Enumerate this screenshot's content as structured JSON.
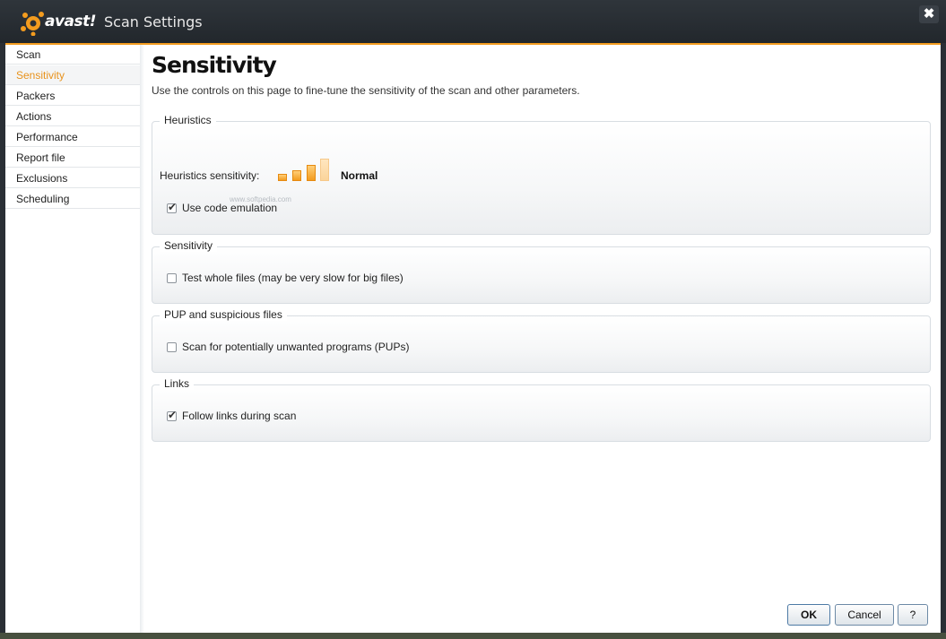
{
  "window": {
    "brand": "avast!",
    "title": "Scan Settings",
    "close_label": "✖"
  },
  "sidebar": {
    "items": [
      {
        "label": "Scan"
      },
      {
        "label": "Sensitivity"
      },
      {
        "label": "Packers"
      },
      {
        "label": "Actions"
      },
      {
        "label": "Performance"
      },
      {
        "label": "Report file"
      },
      {
        "label": "Exclusions"
      },
      {
        "label": "Scheduling"
      }
    ],
    "active_index": 1
  },
  "main": {
    "title": "Sensitivity",
    "description": "Use the controls on this page to fine-tune the sensitivity of the scan and other parameters.",
    "heuristics": {
      "group_label": "Heuristics",
      "sensitivity_label": "Heuristics sensitivity:",
      "level": "Normal",
      "level_bars_filled": 3,
      "level_bars_total": 4,
      "watermark": "www.softpedia.com",
      "code_emulation_label": "Use code emulation",
      "code_emulation_checked": true
    },
    "sensitivity": {
      "group_label": "Sensitivity",
      "whole_files_label": "Test whole files (may be very slow for big files)",
      "whole_files_checked": false
    },
    "pup": {
      "group_label": "PUP and suspicious files",
      "pup_label": "Scan for potentially unwanted programs (PUPs)",
      "pup_checked": false
    },
    "links": {
      "group_label": "Links",
      "follow_label": "Follow links during scan",
      "follow_checked": true
    }
  },
  "footer": {
    "ok_label": "OK",
    "cancel_label": "Cancel",
    "help_label": "?"
  },
  "colors": {
    "accent": "#f39c1f",
    "titlebar": "#2a2f35"
  }
}
